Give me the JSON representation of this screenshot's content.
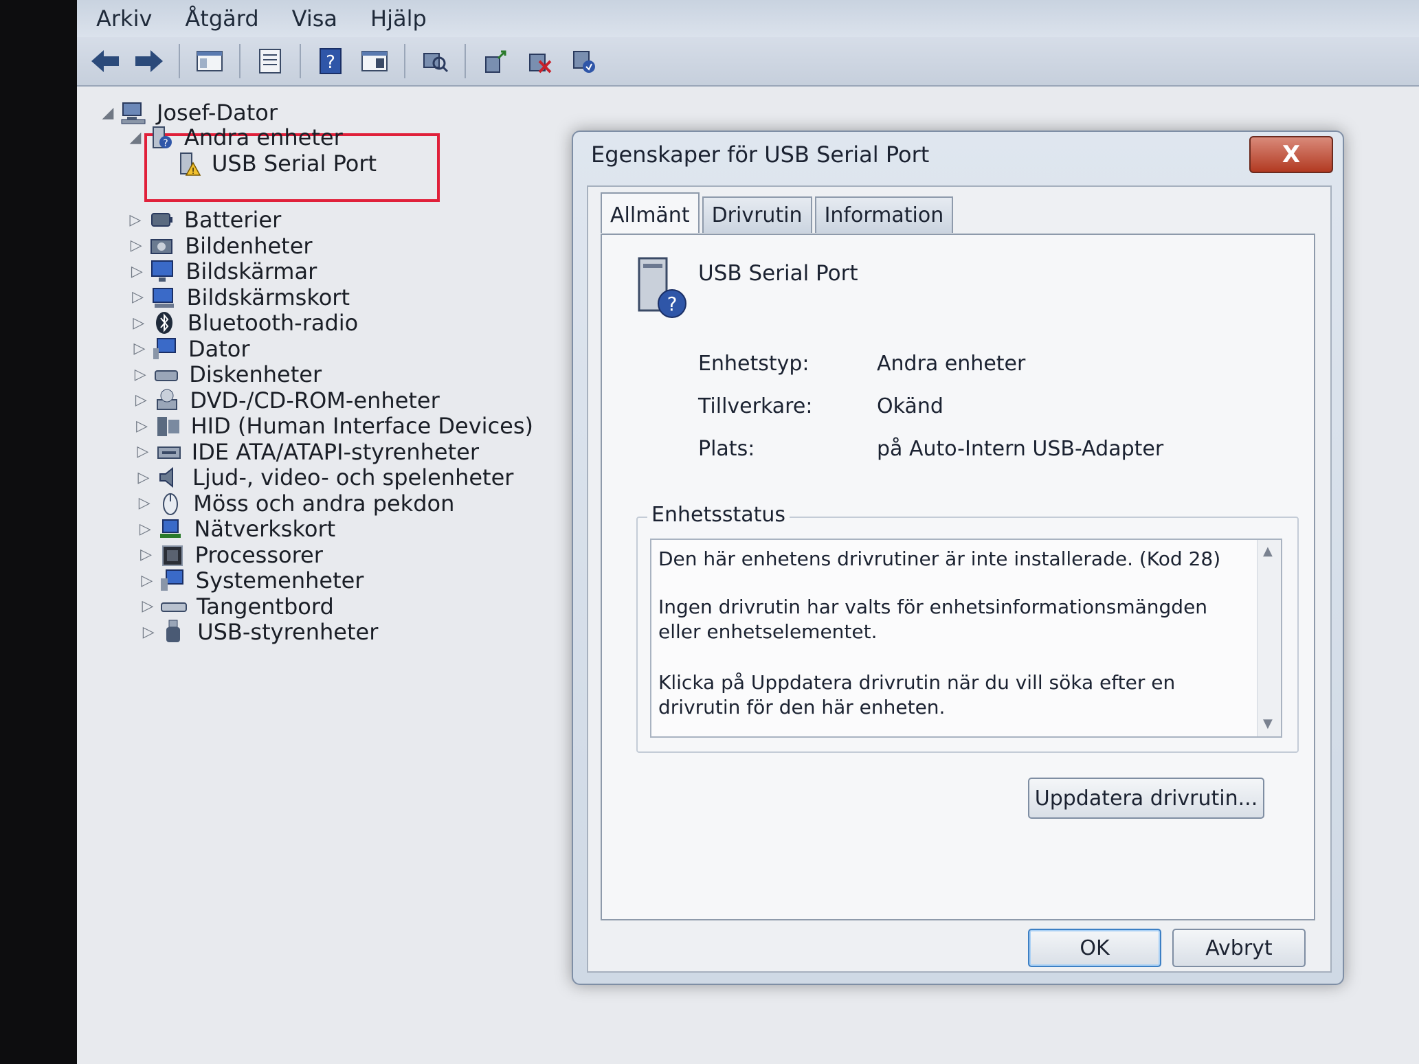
{
  "menu": [
    "Arkiv",
    "Åtgärd",
    "Visa",
    "Hjälp"
  ],
  "toolbar_icons": [
    "back-arrow-icon",
    "forward-arrow-icon",
    "console-tree-icon",
    "properties-icon",
    "help-icon",
    "view-icon",
    "scan-hardware-icon",
    "update-driver-icon",
    "disable-device-icon",
    "uninstall-device-icon"
  ],
  "tree": {
    "root": "Josef-Dator",
    "other_devices": {
      "label": "Andra enheter",
      "children": [
        "USB Serial Port"
      ]
    },
    "categories": [
      "Batterier",
      "Bildenheter",
      "Bildskärmar",
      "Bildskärmskort",
      "Bluetooth-radio",
      "Dator",
      "Diskenheter",
      "DVD-/CD-ROM-enheter",
      "HID (Human Interface Devices)",
      "IDE ATA/ATAPI-styrenheter",
      "Ljud-, video- och spelenheter",
      "Möss och andra pekdon",
      "Nätverkskort",
      "Processorer",
      "Systemenheter",
      "Tangentbord",
      "USB-styrenheter"
    ]
  },
  "dialog": {
    "title": "Egenskaper för USB Serial Port",
    "close": "X",
    "tabs": [
      "Allmänt",
      "Drivrutin",
      "Information"
    ],
    "device_name": "USB Serial Port",
    "props": [
      {
        "label": "Enhetstyp:",
        "value": "Andra enheter"
      },
      {
        "label": "Tillverkare:",
        "value": "Okänd"
      },
      {
        "label": "Plats:",
        "value": "på Auto-Intern USB-Adapter"
      }
    ],
    "status_title": "Enhetsstatus",
    "status_lines": [
      "Den här enhetens drivrutiner är inte installerade. (Kod 28)",
      "Ingen drivrutin har valts för enhetsinformationsmängden eller enhetselementet.",
      "Klicka på Uppdatera drivrutin när du vill söka efter en drivrutin för den här enheten."
    ],
    "update_button": "Uppdatera drivrutin...",
    "ok": "OK",
    "cancel": "Avbryt"
  }
}
